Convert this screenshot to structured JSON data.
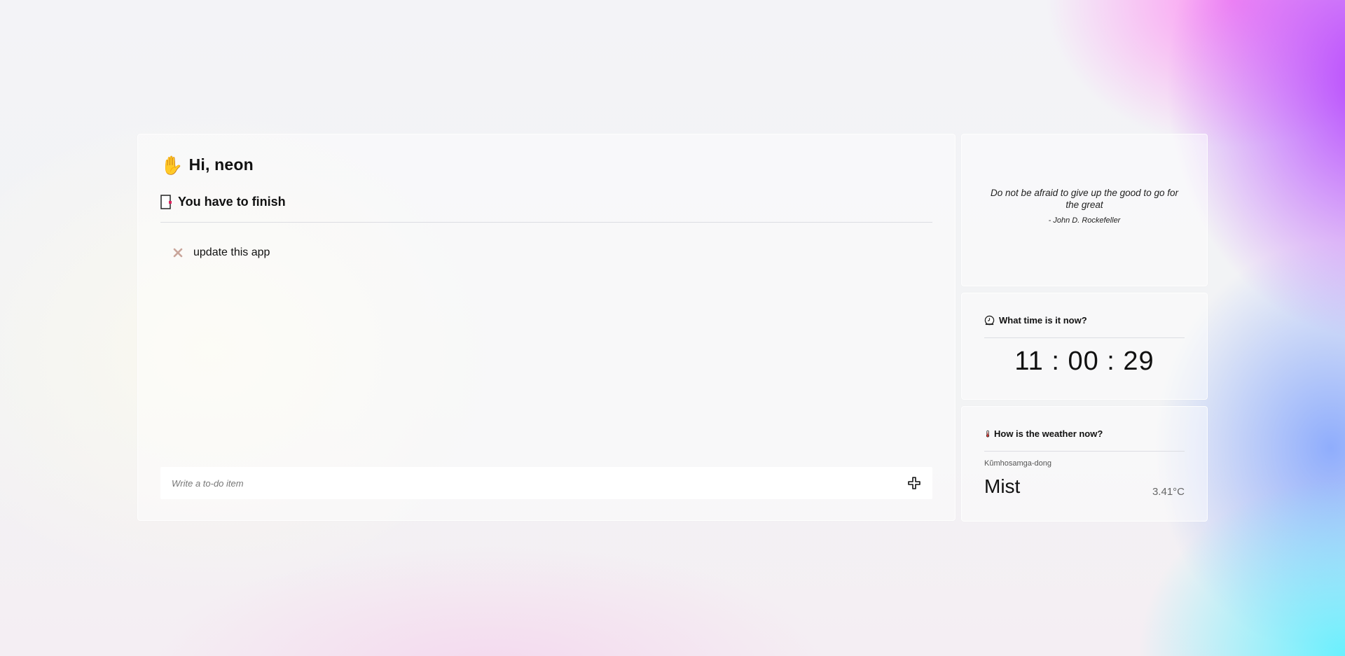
{
  "greeting": {
    "text": "Hi, neon",
    "icon": "waving-hand-icon"
  },
  "todo": {
    "heading": "You have to finish",
    "heading_icon": "document-icon",
    "items": [
      {
        "text": "update this app",
        "delete_icon": "close-x-icon"
      }
    ],
    "input_placeholder": "Write a to-do item",
    "add_icon": "plus-icon"
  },
  "quote": {
    "text": "Do not be afraid to give up the good to go for the great",
    "author": "- John D. Rockefeller"
  },
  "clock": {
    "heading": "What time is it now?",
    "heading_icon": "clock-icon",
    "time": "11 : 00 : 29"
  },
  "weather": {
    "heading": "How is the weather now?",
    "heading_icon": "thermometer-icon",
    "location": "Kŭmhosamga-dong",
    "description": "Mist",
    "temperature": "3.41°C"
  },
  "colors": {
    "accent_purple": "#a52bff",
    "accent_pink": "#ff78f0",
    "accent_cyan": "#5af0ff",
    "delete_icon": "#c9a59b"
  }
}
